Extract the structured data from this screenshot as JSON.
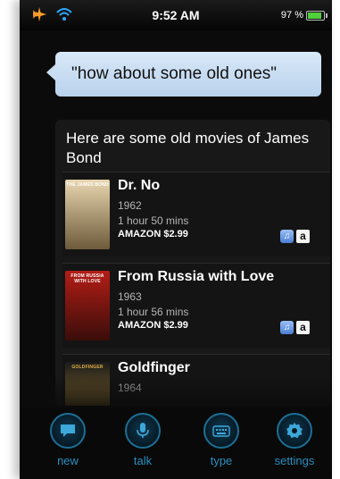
{
  "status_bar": {
    "time": "9:52 AM",
    "battery_text": "97 %",
    "battery_level": 0.97,
    "icons": [
      "airplane-icon",
      "wifi-icon",
      "battery-icon"
    ]
  },
  "query": {
    "text": "\"how about some old ones\""
  },
  "response": {
    "intro": "Here are some old movies of James Bond",
    "movies": [
      {
        "title": "Dr. No",
        "year": "1962",
        "duration": "1 hour 50 mins",
        "price": "AMAZON $2.99",
        "poster_text": "THE JAMES BOND",
        "poster_colors": [
          "#e8d7b0",
          "#6d5a3a"
        ]
      },
      {
        "title": "From Russia with Love",
        "year": "1963",
        "duration": "1 hour 56 mins",
        "price": "AMAZON $2.99",
        "poster_text": "FROM RUSSIA WITH LOVE",
        "poster_colors": [
          "#b31d16",
          "#3a0d0a"
        ]
      },
      {
        "title": "Goldfinger",
        "year": "1964",
        "poster_text": "GOLDFINGER",
        "poster_colors": [
          "#1a1a1a",
          "#c79b3b"
        ]
      }
    ],
    "store_badges": {
      "itunes": "itunes-icon",
      "amazon": "a"
    }
  },
  "toolbar": {
    "new_label": "new",
    "talk_label": "talk",
    "type_label": "type",
    "settings_label": "settings"
  },
  "colors": {
    "query_bubble": "#c9ddf1",
    "toolbar_accent": "#2a8fbf",
    "battery_fill": "#4fcf3a"
  }
}
